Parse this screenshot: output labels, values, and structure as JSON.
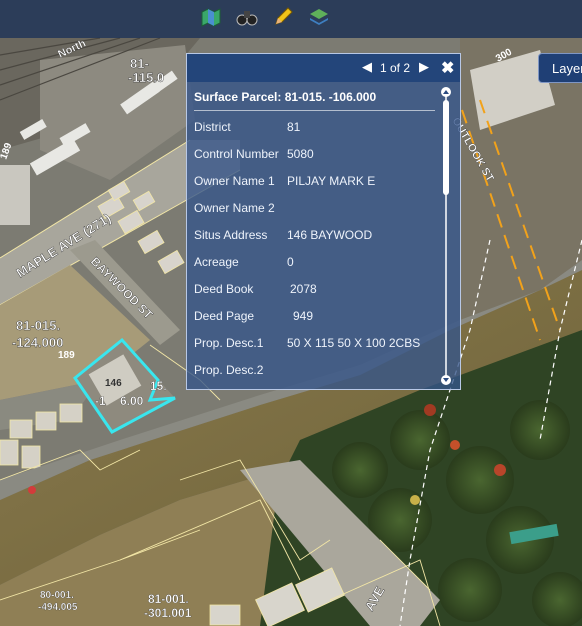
{
  "toolbar": {
    "tools": [
      {
        "icon": "map-icon"
      },
      {
        "icon": "binoculars-icon"
      },
      {
        "icon": "pencil-icon"
      },
      {
        "icon": "layers-stack-icon"
      }
    ]
  },
  "layers_button": {
    "label": "Layer"
  },
  "popup": {
    "page_indicator": "1 of 2",
    "title": "Surface Parcel: 81-015. -106.000",
    "fields": [
      {
        "label": "District",
        "value": "81"
      },
      {
        "label": "Control Number",
        "value": "5080"
      },
      {
        "label": "Owner Name 1",
        "value": "PILJAY MARK E"
      },
      {
        "label": "Owner Name 2",
        "value": ""
      },
      {
        "label": "Situs Address",
        "value": "146 BAYWOOD"
      },
      {
        "label": "Acreage",
        "value": "0"
      },
      {
        "label": "Deed Book",
        "value": "2078"
      },
      {
        "label": "Deed Page",
        "value": "949"
      },
      {
        "label": "Prop. Desc.1",
        "value": "50 X 115  50 X 100  2CBS"
      },
      {
        "label": "Prop. Desc.2",
        "value": ""
      }
    ]
  },
  "map_labels": {
    "maple_ave": "MAPLE AVE (271)",
    "baywood_st": "BAYWOOD ST",
    "outlook_st": "OUTLOOK ST",
    "parcel_81_015_124": "81-015.",
    "parcel_81_015_124b": "-124.000",
    "parcel_81_015_115": "81-",
    "parcel_81_015_115b": "-115.0",
    "parcel_81_015_106": "146",
    "parcel_81_015_106b": "15.",
    "parcel_81_015_106c": "-1",
    "parcel_81_015_106d": "6.00",
    "parcel_81_001_301": "81-001.",
    "parcel_81_001_301b": "-301.001",
    "parcel_80_001": "80-001.",
    "parcel_80_001b": "-494.005",
    "lot_189a": "189",
    "lot_189b": "189",
    "lot_300": "300",
    "ave_label": "AVE",
    "road_top": "North"
  },
  "colors": {
    "toolbar_bg": "#1e3255",
    "popup_bg": "#34548a",
    "popup_header": "#23457a",
    "parcel_highlight": "#39e6ee",
    "parcel_lines": "#f2e6a6",
    "street_dash": "#f2a21a"
  }
}
